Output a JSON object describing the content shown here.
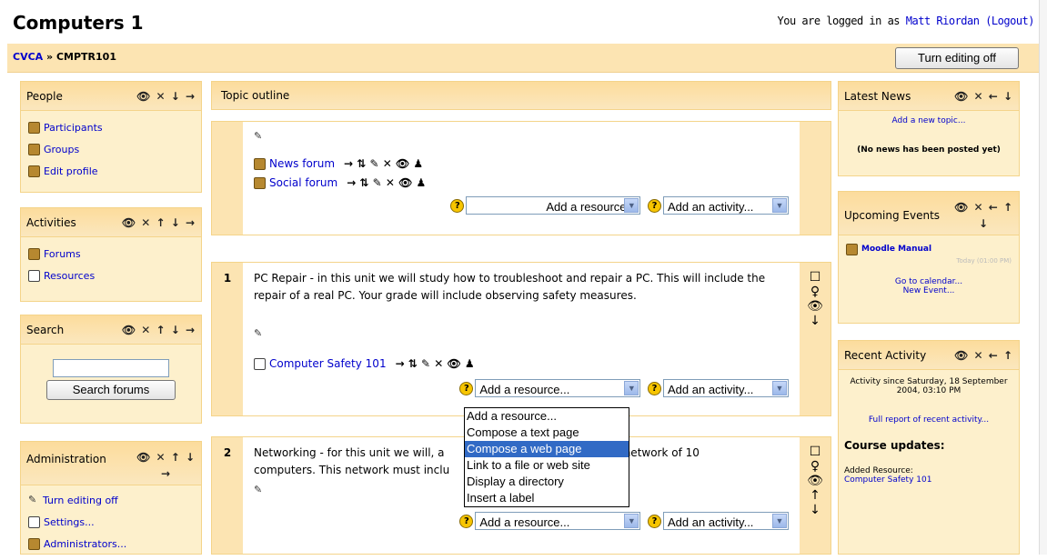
{
  "course": {
    "title": "Computers 1"
  },
  "login": {
    "prefix": "You are logged in as",
    "user": "Matt Riordan",
    "logout": "(Logout)"
  },
  "breadcrumb": {
    "home": "CVCA",
    "sep": "»",
    "course": "CMPTR101"
  },
  "editing_button": "Turn editing off",
  "blocks": {
    "people": {
      "title": "People",
      "controls": "👁 ✕ ↓ →",
      "items": [
        "Participants",
        "Groups",
        "Edit profile"
      ]
    },
    "activities": {
      "title": "Activities",
      "controls": "👁 ✕ ↑ ↓ →",
      "items": [
        "Forums",
        "Resources"
      ]
    },
    "search": {
      "title": "Search",
      "controls": "👁 ✕ ↑ ↓ →",
      "button": "Search forums",
      "input_value": ""
    },
    "admin": {
      "title": "Administration",
      "controls": "👁 ✕ ↑ ↓",
      "controls2": "→",
      "items": [
        "Turn editing off",
        "Settings...",
        "Administrators..."
      ]
    },
    "news": {
      "title": "Latest News",
      "controls": "👁 ✕ ← ↓",
      "add_link": "Add a new topic...",
      "empty": "(No news has been posted yet)"
    },
    "events": {
      "title": "Upcoming Events",
      "controls": "👁 ✕ ← ↑",
      "controls2": "↓",
      "event_name": "Moodle Manual",
      "event_time": "Today (01:00 PM)",
      "calendar_link": "Go to calendar...",
      "new_event": "New Event..."
    },
    "recent": {
      "title": "Recent Activity",
      "controls": "👁 ✕ ← ↑",
      "since": "Activity since Saturday, 18 September 2004, 03:10 PM",
      "full_report": "Full report of recent activity...",
      "updates_title": "Course updates:",
      "added_label": "Added Resource:",
      "added_item": "Computer Safety 101"
    }
  },
  "main": {
    "header": "Topic outline",
    "section0": {
      "items": [
        "News forum",
        "Social forum"
      ],
      "item_controls": "→ ⇅ ✎ ✕ 👁 ♟"
    },
    "section1": {
      "number": "1",
      "summary": "PC Repair - in this unit we will study how to troubleshoot and repair a PC. This will include the repair of a real PC. Your grade will include observing safety measures.",
      "resource": "Computer Safety 101"
    },
    "section2": {
      "number": "2",
      "summary_a": "Networking - for this unit we will, a",
      "summary_b": "a network of 10",
      "summary_c": "computers. This network must inclu"
    },
    "resource_select": "Add a resource...",
    "activity_select": "Add an activity..."
  },
  "dropdown": {
    "options": [
      "Add a resource...",
      "Compose a text page",
      "Compose a web page",
      "Link to a file or web site",
      "Display a directory",
      "Insert a label"
    ],
    "highlighted_index": 2
  },
  "colors": {
    "block_bg": "#fdf0cc",
    "header_bg": "#fcdc9c",
    "link": "#0000cc",
    "highlight": "#316ac5"
  }
}
